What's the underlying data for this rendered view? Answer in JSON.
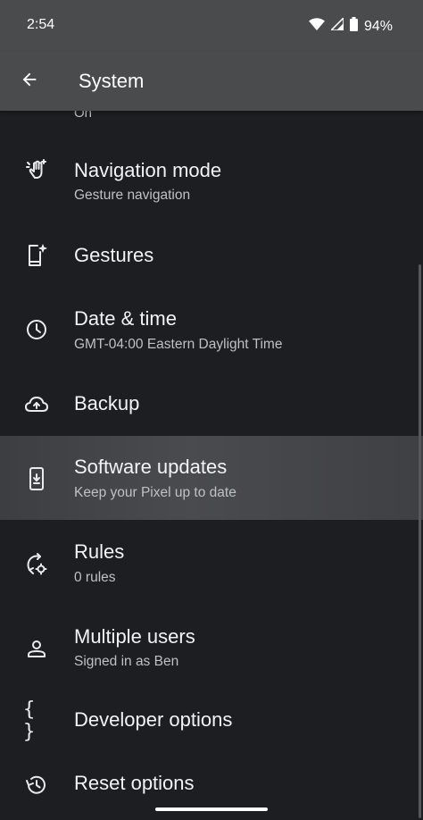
{
  "status_bar": {
    "time": "2:54",
    "battery": "94%"
  },
  "app_bar": {
    "title": "System"
  },
  "partial_item": {
    "subtitle": "On"
  },
  "items": [
    {
      "title": "Navigation mode",
      "subtitle": "Gesture navigation",
      "icon": "gesture-hand-icon"
    },
    {
      "title": "Gestures",
      "subtitle": "",
      "icon": "phone-sparkle-icon"
    },
    {
      "title": "Date & time",
      "subtitle": "GMT-04:00 Eastern Daylight Time",
      "icon": "clock-icon"
    },
    {
      "title": "Backup",
      "subtitle": "",
      "icon": "cloud-upload-icon"
    },
    {
      "title": "Software updates",
      "subtitle": "Keep your Pixel up to date",
      "icon": "system-update-icon"
    },
    {
      "title": "Rules",
      "subtitle": "0 rules",
      "icon": "rules-icon"
    },
    {
      "title": "Multiple users",
      "subtitle": "Signed in as Ben",
      "icon": "person-icon"
    },
    {
      "title": "Developer options",
      "subtitle": "",
      "icon": "braces-icon"
    },
    {
      "title": "Reset options",
      "subtitle": "",
      "icon": "history-icon"
    }
  ],
  "colors": {
    "app_bar": "#4a4b4d",
    "background": "#1c1e21",
    "highlight": "#4a4b4e"
  }
}
